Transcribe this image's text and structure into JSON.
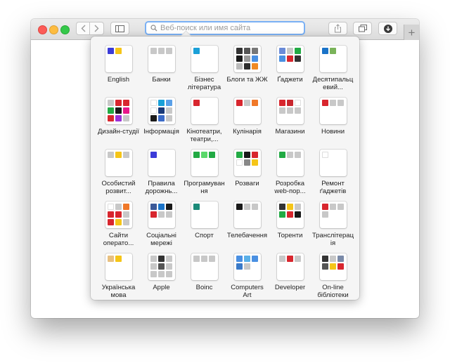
{
  "toolbar": {
    "search_placeholder": "Веб-поиск или имя сайта",
    "new_tab_label": "+"
  },
  "favorites": [
    {
      "label": "English",
      "tiles": [
        "#3b3bd8",
        "#f5c518"
      ]
    },
    {
      "label": "Банки",
      "tiles": [
        "#c8c8c8",
        "#c8c8c8",
        "#c8c8c8"
      ]
    },
    {
      "label": "Бізнес література",
      "tiles": [
        "#1aa0d8"
      ]
    },
    {
      "label": "Блоги та ЖЖ",
      "tiles": [
        "#333333",
        "#555555",
        "#777777",
        "#1a1a1a",
        "#999999",
        "#4a90e2",
        "#bbbbbb",
        "#2e2e2e",
        "#f08a24"
      ]
    },
    {
      "label": "Ґаджети",
      "tiles": [
        "#6a8bd8",
        "#c8c8c8",
        "#22aa44",
        "#4a90e2",
        "#d8262e",
        "#333333"
      ]
    },
    {
      "label": "Десятипальцевий...",
      "tiles": [
        "#1a73c8",
        "#7ab35a"
      ]
    },
    {
      "label": "Дизайн-студії",
      "tiles": [
        "#c8c8c8",
        "#d8262e",
        "#d8262e",
        "#22aa44",
        "#1a1a1a",
        "#e8178a",
        "#d8262e",
        "#9b30d8",
        "#c8c8c8"
      ]
    },
    {
      "label": "Інформація",
      "tiles": [
        "#ffffff",
        "#1aa0d8",
        "#5aa0e8",
        "#ffffff",
        "#1a3a78",
        "#c8c8c8",
        "#1a1a1a",
        "#3b6bc8",
        "#c8c8c8"
      ]
    },
    {
      "label": "Кінотеатри, театри,...",
      "tiles": [
        "#d8262e"
      ]
    },
    {
      "label": "Кулінарія",
      "tiles": [
        "#d8262e",
        "#c8c8c8",
        "#f07828"
      ]
    },
    {
      "label": "Магазини",
      "tiles": [
        "#d8262e",
        "#c8262e",
        "#ffffff",
        "#c8c8c8",
        "#c8c8c8",
        "#c8c8c8"
      ]
    },
    {
      "label": "Новини",
      "tiles": [
        "#d8262e",
        "#c8c8c8",
        "#c8c8c8"
      ]
    },
    {
      "label": "Особистий розвит...",
      "tiles": [
        "#c8c8c8",
        "#f5c518",
        "#c8c8c8"
      ]
    },
    {
      "label": "Правила дорожнь...",
      "tiles": [
        "#3b3bd8"
      ]
    },
    {
      "label": "Програмування",
      "tiles": [
        "#22aa44",
        "#5ad86a",
        "#22aa44"
      ]
    },
    {
      "label": "Розваги",
      "tiles": [
        "#22aa44",
        "#1a1a1a",
        "#d8262e",
        "#ffffff",
        "#888888",
        "#f5c518"
      ]
    },
    {
      "label": "Розробка web-пор...",
      "tiles": [
        "#22aa44",
        "#c8c8c8",
        "#c8c8c8"
      ]
    },
    {
      "label": "Ремонт ґаджетів",
      "tiles": [
        "#ffffff"
      ]
    },
    {
      "label": "Сайти операто...",
      "tiles": [
        "#ffffff",
        "#c8c8c8",
        "#f07828",
        "#d8262e",
        "#d8262e",
        "#c8c8c8",
        "#d8262e",
        "#f5c518",
        "#c8c8c8"
      ]
    },
    {
      "label": "Соціальні мережі",
      "tiles": [
        "#3b5998",
        "#1a73c8",
        "#1a1a1a",
        "#d8262e",
        "#c8c8c8",
        "#c8c8c8"
      ]
    },
    {
      "label": "Спорт",
      "tiles": [
        "#1a8a78"
      ]
    },
    {
      "label": "Телебачення",
      "tiles": [
        "#1a1a1a",
        "#c8c8c8",
        "#c8c8c8"
      ]
    },
    {
      "label": "Торенти",
      "tiles": [
        "#333333",
        "#f5c518",
        "#c8c8c8",
        "#22aa44",
        "#d8262e",
        "#1a1a1a"
      ]
    },
    {
      "label": "Транслітерація",
      "tiles": [
        "#d8262e",
        "#c8c8c8",
        "#c8c8c8",
        "#c8c8c8"
      ]
    },
    {
      "label": "Українська мова",
      "tiles": [
        "#e8c080",
        "#f5c518"
      ]
    },
    {
      "label": "Apple",
      "tiles": [
        "#c8c8c8",
        "#333333",
        "#c8c8c8",
        "#c8c8c8",
        "#555555",
        "#c8c8c8",
        "#c8c8c8",
        "#c8c8c8",
        "#c8c8c8"
      ]
    },
    {
      "label": "Boinc",
      "tiles": [
        "#c8c8c8",
        "#c8c8c8",
        "#c8c8c8"
      ]
    },
    {
      "label": "Computers Art",
      "tiles": [
        "#4a90e2",
        "#5ab0e8",
        "#4a90e2",
        "#3a7ac8",
        "#c8c8c8"
      ]
    },
    {
      "label": "Developer",
      "tiles": [
        "#c8c8c8",
        "#d8262e",
        "#c8c8c8"
      ]
    },
    {
      "label": "On-line бібліотеки",
      "tiles": [
        "#333333",
        "#c8c8c8",
        "#7a8aa8",
        "#555555",
        "#f5c518",
        "#d8262e"
      ]
    }
  ]
}
